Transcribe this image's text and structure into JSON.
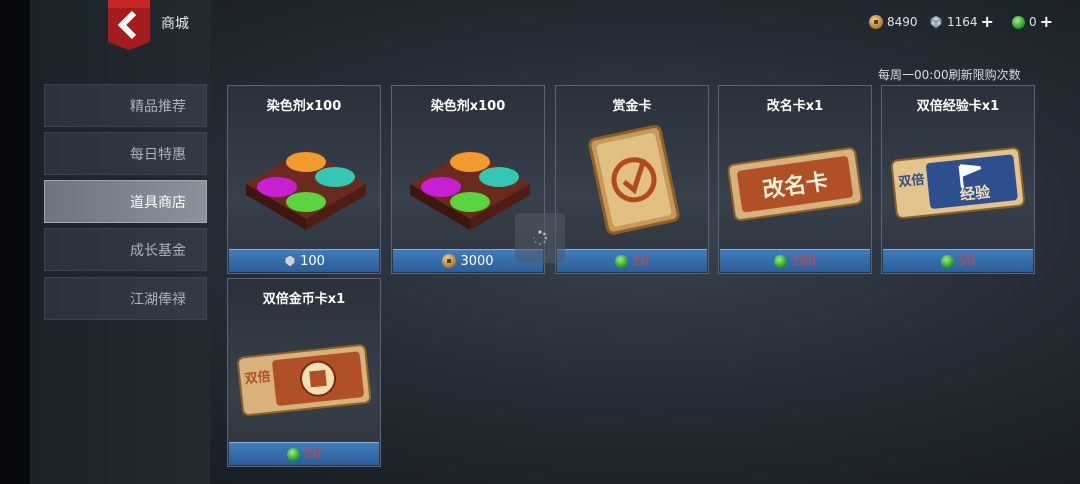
{
  "header": {
    "title": "商城"
  },
  "currencies": [
    {
      "icon": "copper-coin-icon",
      "value": "8490",
      "has_plus": false
    },
    {
      "icon": "silver-gem-icon",
      "value": "1164",
      "has_plus": true
    },
    {
      "icon": "jade-icon",
      "value": "0",
      "has_plus": true
    }
  ],
  "notice": "每周一00:00刷新限购次数",
  "sidebar": {
    "items": [
      {
        "label": "精品推荐"
      },
      {
        "label": "每日特惠"
      },
      {
        "label": "道具商店",
        "active": true
      },
      {
        "label": "成长基金"
      },
      {
        "label": "江湖俸禄"
      }
    ]
  },
  "items": [
    {
      "title": "染色剂x100",
      "image": "dye-box-icon",
      "currency": "silver-gem-icon",
      "price": "100",
      "price_color": "#ffffff"
    },
    {
      "title": "染色剂x100",
      "image": "dye-box-icon",
      "currency": "copper-coin-icon",
      "price": "3000",
      "price_color": "#ffffff"
    },
    {
      "title": "赏金卡",
      "image": "bounty-card-icon",
      "currency": "jade-icon",
      "price": "10",
      "price_color": "#e23a3a"
    },
    {
      "title": "改名卡x1",
      "image": "rename-card-icon",
      "currency": "jade-icon",
      "price": "180",
      "price_color": "#e23a3a",
      "art_text": "改名卡"
    },
    {
      "title": "双倍经验卡x1",
      "image": "double-exp-card-icon",
      "currency": "jade-icon",
      "price": "50",
      "price_color": "#e23a3a",
      "art_text_left": "双倍",
      "art_text_right": "经验"
    },
    {
      "title": "双倍金币卡x1",
      "image": "double-coin-card-icon",
      "currency": "jade-icon",
      "price": "50",
      "price_color": "#e23a3a",
      "art_text_left": "双倍"
    }
  ],
  "colors": {
    "accent_red": "#b21e1e",
    "price_bar_blue": "#3f7cbd",
    "price_red": "#e23a3a"
  }
}
